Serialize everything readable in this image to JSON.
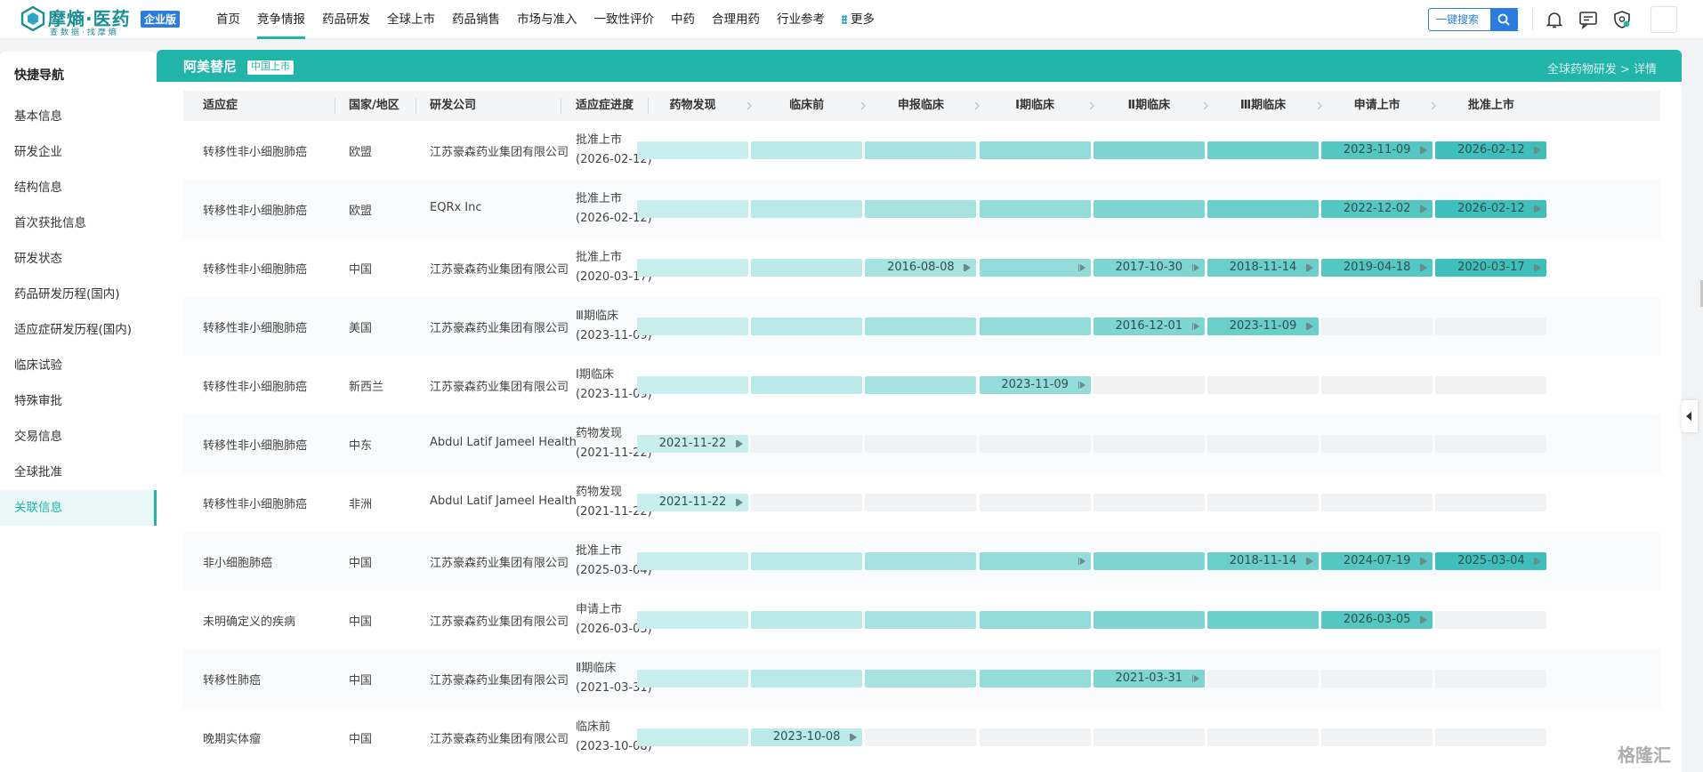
{
  "brand": {
    "name": "摩熵·医药",
    "tagline": "查数据·找摩熵",
    "badge": "企业版"
  },
  "nav": [
    "首页",
    "竞争情报",
    "药品研发",
    "全球上市",
    "药品销售",
    "市场与准入",
    "一致性评价",
    "中药",
    "合理用药",
    "行业参考",
    "更多"
  ],
  "nav_active": "竞争情报",
  "search": {
    "label": "一键搜索"
  },
  "sidebar": {
    "title": "快捷导航",
    "items": [
      "基本信息",
      "研发企业",
      "结构信息",
      "首次获批信息",
      "研发状态",
      "药品研发历程(国内)",
      "适应症研发历程(国内)",
      "临床试验",
      "特殊审批",
      "交易信息",
      "全球批准",
      "关联信息"
    ],
    "active": "关联信息"
  },
  "header": {
    "drug": "阿美替尼",
    "tag": "中国上市",
    "breadcrumb": "全球药物研发 > 详情"
  },
  "table": {
    "columns": [
      "适应症",
      "国家/地区",
      "研发公司",
      "适应症进度"
    ],
    "stages": [
      "药物发现",
      "临床前",
      "申报临床",
      "Ⅰ期临床",
      "Ⅱ期临床",
      "Ⅲ期临床",
      "申请上市",
      "批准上市"
    ],
    "stage_colors": [
      "#c9eeee",
      "#b9e9e8",
      "#a6e3e1",
      "#93dcda",
      "#7fd5d2",
      "#6acecb",
      "#55c7c3",
      "#3fbfbb"
    ],
    "empty_color": "#f1f2f4",
    "rows": [
      {
        "indication": "转移性非小细胞肺癌",
        "region": "欧盟",
        "company": "江苏豪森药业集团有限公司",
        "progress": "批准上市",
        "progress_date": "(2026-02-12)",
        "filled": 8,
        "labels": {
          "6": "2023-11-09",
          "7": "2026-02-12"
        }
      },
      {
        "indication": "转移性非小细胞肺癌",
        "region": "欧盟",
        "company": "EQRx Inc",
        "progress": "批准上市",
        "progress_date": "(2026-02-12)",
        "filled": 8,
        "labels": {
          "6": "2022-12-02",
          "7": "2026-02-12"
        }
      },
      {
        "indication": "转移性非小细胞肺癌",
        "region": "中国",
        "company": "江苏豪森药业集团有限公司",
        "progress": "批准上市",
        "progress_date": "(2020-03-17)",
        "filled": 8,
        "labels": {
          "2": "2016-08-08",
          "3": "",
          "4": "2017-10-30",
          "5": "2018-11-14",
          "6": "2019-04-18",
          "7": "2020-03-17"
        }
      },
      {
        "indication": "转移性非小细胞肺癌",
        "region": "美国",
        "company": "江苏豪森药业集团有限公司",
        "progress": "Ⅲ期临床",
        "progress_date": "(2023-11-09)",
        "filled": 6,
        "labels": {
          "4": "2016-12-01",
          "5": "2023-11-09"
        }
      },
      {
        "indication": "转移性非小细胞肺癌",
        "region": "新西兰",
        "company": "江苏豪森药业集团有限公司",
        "progress": "Ⅰ期临床",
        "progress_date": "(2023-11-09)",
        "filled": 4,
        "labels": {
          "3": "2023-11-09"
        }
      },
      {
        "indication": "转移性非小细胞肺癌",
        "region": "中东",
        "company": "Abdul Latif Jameel Health",
        "progress": "药物发现",
        "progress_date": "(2021-11-22)",
        "filled": 1,
        "labels": {
          "0": "2021-11-22"
        }
      },
      {
        "indication": "转移性非小细胞肺癌",
        "region": "非洲",
        "company": "Abdul Latif Jameel Health",
        "progress": "药物发现",
        "progress_date": "(2021-11-22)",
        "filled": 1,
        "labels": {
          "0": "2021-11-22"
        }
      },
      {
        "indication": "非小细胞肺癌",
        "region": "中国",
        "company": "江苏豪森药业集团有限公司",
        "progress": "批准上市",
        "progress_date": "(2025-03-04)",
        "filled": 8,
        "labels": {
          "3": "",
          "5": "2018-11-14",
          "6": "2024-07-19",
          "7": "2025-03-04"
        }
      },
      {
        "indication": "未明确定义的疾病",
        "region": "中国",
        "company": "江苏豪森药业集团有限公司",
        "progress": "申请上市",
        "progress_date": "(2026-03-05)",
        "filled": 7,
        "labels": {
          "6": "2026-03-05"
        }
      },
      {
        "indication": "转移性肺癌",
        "region": "中国",
        "company": "江苏豪森药业集团有限公司",
        "progress": "Ⅱ期临床",
        "progress_date": "(2021-03-31)",
        "filled": 5,
        "labels": {
          "4": "2021-03-31"
        }
      },
      {
        "indication": "晚期实体瘤",
        "region": "中国",
        "company": "江苏豪森药业集团有限公司",
        "progress": "临床前",
        "progress_date": "(2023-10-08)",
        "filled": 2,
        "labels": {
          "1": "2023-10-08"
        }
      }
    ]
  },
  "watermark": "格隆汇"
}
